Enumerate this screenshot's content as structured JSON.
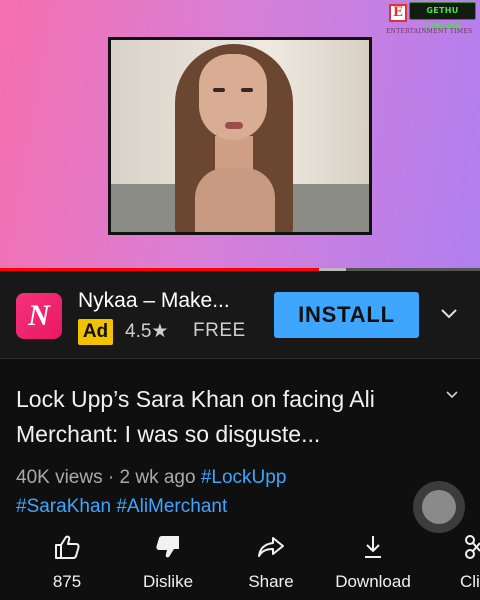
{
  "video": {
    "logos": {
      "e_letter": "E",
      "channel": "GETHU CINEMA",
      "outlet": "ENTERTAINMENT TIMES"
    },
    "progress": {
      "played_fraction": 0.665,
      "buffered_fraction": 0.055
    }
  },
  "ad": {
    "icon": "nykaa-app-icon",
    "icon_letter": "N",
    "title": "Nykaa – Make...",
    "badge": "Ad",
    "rating": "4.5★",
    "price": "FREE",
    "install_label": "INSTALL",
    "menu_icon": "chevron-down-icon"
  },
  "video_info": {
    "title": "Lock Upp’s Sara Khan on facing Ali Merchant: I was so disguste...",
    "views": "40K views",
    "age": "2 wk ago",
    "hashtags": [
      "#LockUpp",
      "#SaraKhan",
      "#AliMerchant"
    ]
  },
  "actions": {
    "like_count": "875",
    "dislike_label": "Dislike",
    "share_label": "Share",
    "download_label": "Download",
    "clip_label": "Cli"
  },
  "colors": {
    "accent_blue": "#3ea6ff",
    "progress_red": "#ff0000",
    "ad_badge_yellow": "#f2c200",
    "background": "#0f0f0f"
  }
}
